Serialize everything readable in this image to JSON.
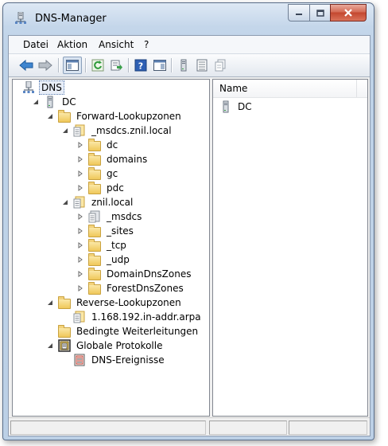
{
  "window": {
    "title": "DNS-Manager"
  },
  "menu": [
    "Datei",
    "Aktion",
    "Ansicht",
    "?"
  ],
  "toolbar": {
    "buttons": [
      "back-arrow-icon",
      "forward-arrow-icon",
      "show-hide-tree-icon",
      "refresh-icon",
      "export-list-icon",
      "help-icon",
      "properties-pane-icon",
      "server-icon",
      "list-icon",
      "copy-icon"
    ]
  },
  "tree": {
    "root": "DNS",
    "server": "DC",
    "forward_zones": "Forward-Lookupzonen",
    "msdcs_zone": "_msdcs.znil.local",
    "msdcs_children": [
      "dc",
      "domains",
      "gc",
      "pdc"
    ],
    "znil_zone": "znil.local",
    "znil_children": [
      "_msdcs",
      "_sites",
      "_tcp",
      "_udp",
      "DomainDnsZones",
      "ForestDnsZones"
    ],
    "reverse_zones": "Reverse-Lookupzonen",
    "reverse_zone": "1.168.192.in-addr.arpa",
    "conditional_forwarders": "Bedingte Weiterleitungen",
    "global_logs": "Globale Protokolle",
    "dns_events": "DNS-Ereignisse"
  },
  "list": {
    "column_name": "Name",
    "items": [
      "DC"
    ]
  },
  "colors": {
    "folder": "#f0c85a",
    "selection": "#e8eef8",
    "frame": "#bcd0e6"
  }
}
